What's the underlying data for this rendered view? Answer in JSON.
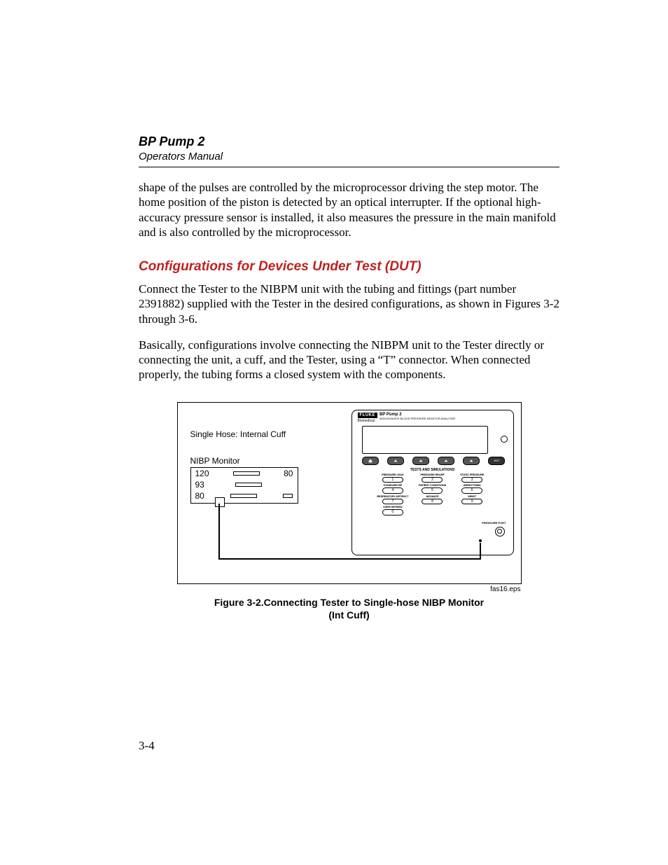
{
  "header": {
    "title": "BP Pump 2",
    "subtitle": "Operators Manual"
  },
  "paragraphs": {
    "p1": "shape of the pulses are controlled by the microprocessor driving the step motor. The home position of the piston is detected by an optical interrupter.  If the optional high-accuracy pressure sensor is installed, it also measures the pressure in the main manifold and is also controlled by the microprocessor.",
    "p2": "Connect the Tester to the NIBPM unit with the tubing and fittings (part number 2391882) supplied with the Tester in the desired configurations, as shown in Figures 3-2 through 3-6.",
    "p3": "Basically, configurations involve connecting the NIBPM unit to the Tester directly or connecting the unit, a cuff, and the Tester, using a “T” connector.  When connected properly, the tubing forms a closed system with the components."
  },
  "section_heading": "Configurations for Devices Under Test (DUT)",
  "figure": {
    "label_top": "Single Hose: Internal Cuff",
    "label_monitor": "NIBP Monitor",
    "nibp_values": {
      "a": "120",
      "b": "93",
      "c": "80",
      "right": "80"
    },
    "tester": {
      "brand": "FLUKE",
      "brand_sub": "Biomedical",
      "product_name": "BP Pump 2",
      "product_desc": "NON-INVASIVE BLOOD PRESSURE MONITOR ANALYZER",
      "enter": "ENT",
      "ts_title": "TESTS AND SIMULATIONS",
      "buttons": [
        {
          "label": "PRESSURE LEAK",
          "num": "1"
        },
        {
          "label": "PRESSURE RELIEF",
          "num": "2"
        },
        {
          "label": "STATIC PRESSURE",
          "num": "3"
        },
        {
          "label": "STANDARD BP",
          "num": "4"
        },
        {
          "label": "PATIENT CONDITIONS",
          "num": "5"
        },
        {
          "label": "ARRHYTHMIA",
          "num": "6"
        },
        {
          "label": "RESPIRATORY ARTIFACT",
          "num": "7"
        },
        {
          "label": "NEONATE",
          "num": "8"
        },
        {
          "label": "WRIST",
          "num": "9"
        },
        {
          "label": "USER DEFINED",
          "num": "0"
        }
      ],
      "pressure_port": "PRESSURE PORT"
    },
    "eps": "fas16.eps",
    "caption_line1": "Figure 3-2.Connecting Tester to Single-hose NIBP Monitor",
    "caption_line2": "(Int Cuff)"
  },
  "page_number": "3-4"
}
